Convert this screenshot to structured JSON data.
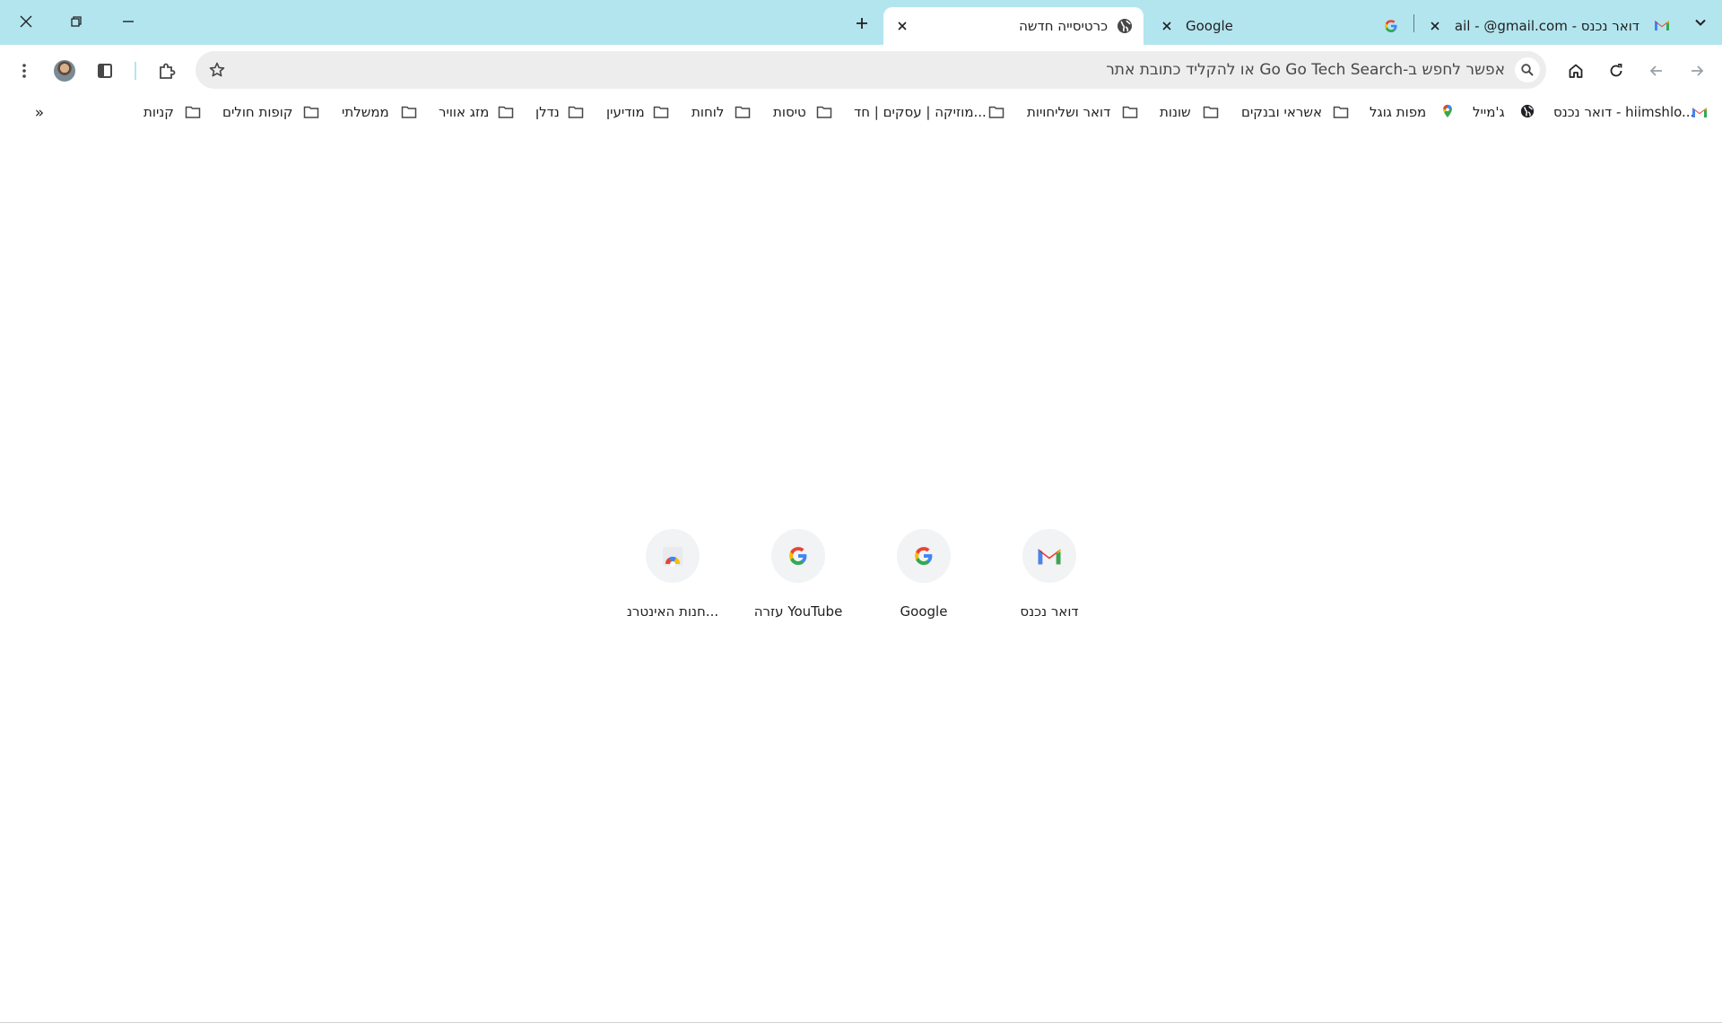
{
  "window": {
    "close_icon": "close-icon",
    "restore_icon": "restore-icon",
    "minimize_icon": "minimize-icon",
    "titlebar_color": "#b3e5ef"
  },
  "tabs": [
    {
      "title": "דואר נכנס - Gmail - ‎@gmail.com",
      "favicon": "gmail-icon",
      "active": false
    },
    {
      "title": "Google",
      "favicon": "google-g-icon",
      "active": false
    },
    {
      "title": "כרטיסייה חדשה",
      "favicon": "globe-icon",
      "active": true
    }
  ],
  "new_tab_icon": "plus-icon",
  "tab_list_icon": "chevron-down-icon",
  "toolbar": {
    "omnibox_placeholder": "אפשר לחפש ב-Go Go Tech Search או להקליד כתובת אתר",
    "forward_icon": "arrow-right-icon",
    "back_icon": "arrow-left-icon",
    "reload_icon": "reload-icon",
    "home_icon": "home-icon",
    "search_icon": "search-icon",
    "star_icon": "star-icon",
    "extensions_icon": "puzzle-icon",
    "side_panel_icon": "side-panel-icon",
    "menu_icon": "kebab-menu-icon",
    "avatar": "profile-avatar"
  },
  "bookmarks": [
    {
      "label": "דואר נכנס - hiimshlo...",
      "icon": "gmail-icon"
    },
    {
      "label": "ג'מייל",
      "icon": "globe-icon"
    },
    {
      "label": "מפות גוגל",
      "icon": "maps-pin-icon"
    },
    {
      "label": "אשראי ובנקים",
      "icon": "folder-icon"
    },
    {
      "label": "שונות",
      "icon": "folder-icon"
    },
    {
      "label": "דואר ושליחויות",
      "icon": "folder-icon"
    },
    {
      "label": "מוזיקה | עסקים | חד...",
      "icon": "folder-icon"
    },
    {
      "label": "טיסות",
      "icon": "folder-icon"
    },
    {
      "label": "לוחות",
      "icon": "folder-icon"
    },
    {
      "label": "מודיעין",
      "icon": "folder-icon"
    },
    {
      "label": "נדלן",
      "icon": "folder-icon"
    },
    {
      "label": "מזג אוויר",
      "icon": "folder-icon"
    },
    {
      "label": "ממשלתי",
      "icon": "folder-icon"
    },
    {
      "label": "קופות חולים",
      "icon": "folder-icon"
    },
    {
      "label": "קניות",
      "icon": "folder-icon"
    }
  ],
  "bookmarks_overflow": "»",
  "shortcuts": [
    {
      "label": "דואר נכנס",
      "icon": "gmail-icon"
    },
    {
      "label": "Google",
      "icon": "google-g-icon"
    },
    {
      "label": "עזרה YouTube",
      "icon": "google-g-icon"
    },
    {
      "label": "חנות האינטרנ...",
      "icon": "chrome-web-store-icon"
    }
  ]
}
